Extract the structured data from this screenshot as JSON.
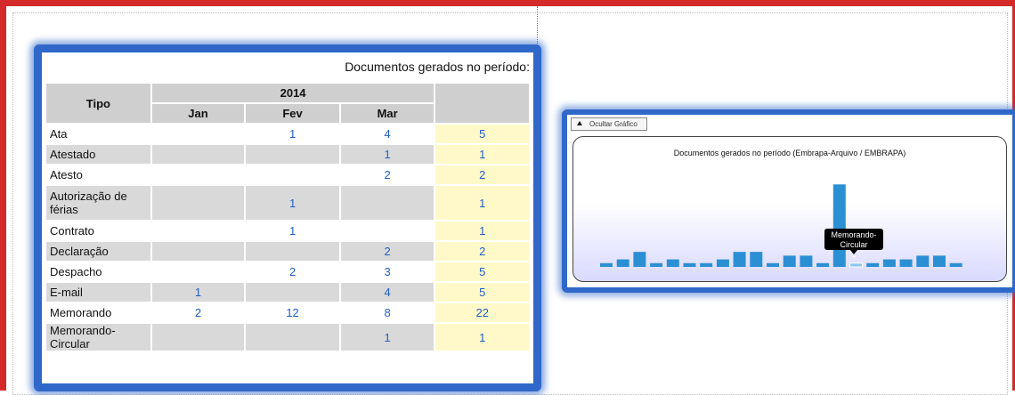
{
  "table": {
    "caption": "Documentos gerados no período:",
    "col_tipo": "Tipo",
    "year": "2014",
    "months": [
      "Jan",
      "Fev",
      "Mar"
    ],
    "rows": [
      {
        "tipo": "Ata",
        "jan": "",
        "fev": "1",
        "mar": "4",
        "total": "5"
      },
      {
        "tipo": "Atestado",
        "jan": "",
        "fev": "",
        "mar": "1",
        "total": "1"
      },
      {
        "tipo": "Atesto",
        "jan": "",
        "fev": "",
        "mar": "2",
        "total": "2"
      },
      {
        "tipo": "Autorização de férias",
        "jan": "",
        "fev": "1",
        "mar": "",
        "total": "1"
      },
      {
        "tipo": "Contrato",
        "jan": "",
        "fev": "1",
        "mar": "",
        "total": "1"
      },
      {
        "tipo": "Declaração",
        "jan": "",
        "fev": "",
        "mar": "2",
        "total": "2"
      },
      {
        "tipo": "Despacho",
        "jan": "",
        "fev": "2",
        "mar": "3",
        "total": "5"
      },
      {
        "tipo": "E-mail",
        "jan": "1",
        "fev": "",
        "mar": "4",
        "total": "5"
      },
      {
        "tipo": "Memorando",
        "jan": "2",
        "fev": "12",
        "mar": "8",
        "total": "22"
      },
      {
        "tipo": "Memorando-Circular",
        "jan": "",
        "fev": "",
        "mar": "1",
        "total": "1"
      }
    ]
  },
  "chart": {
    "hide_button_label": "Ocultar Gráfico",
    "hide_button_icon": "triangle-up-icon",
    "title": "Documentos gerados no período (Embrapa-Arquivo / EMBRAPA)",
    "tooltip_label": "Memorando-Circular",
    "tooltip_value": "1",
    "bar_color": "#2b8fd4",
    "highlight_color": "#8cc6f0"
  },
  "chart_data": {
    "type": "bar",
    "title": "Documentos gerados no período (Embrapa-Arquivo / EMBRAPA)",
    "values": [
      1,
      2,
      4,
      1,
      2,
      1,
      1,
      2,
      4,
      4,
      1,
      3,
      3,
      1,
      22,
      1,
      1,
      2,
      2,
      3,
      3,
      1
    ],
    "highlighted_index": 15,
    "ylim": [
      0,
      28
    ],
    "grid": false
  }
}
